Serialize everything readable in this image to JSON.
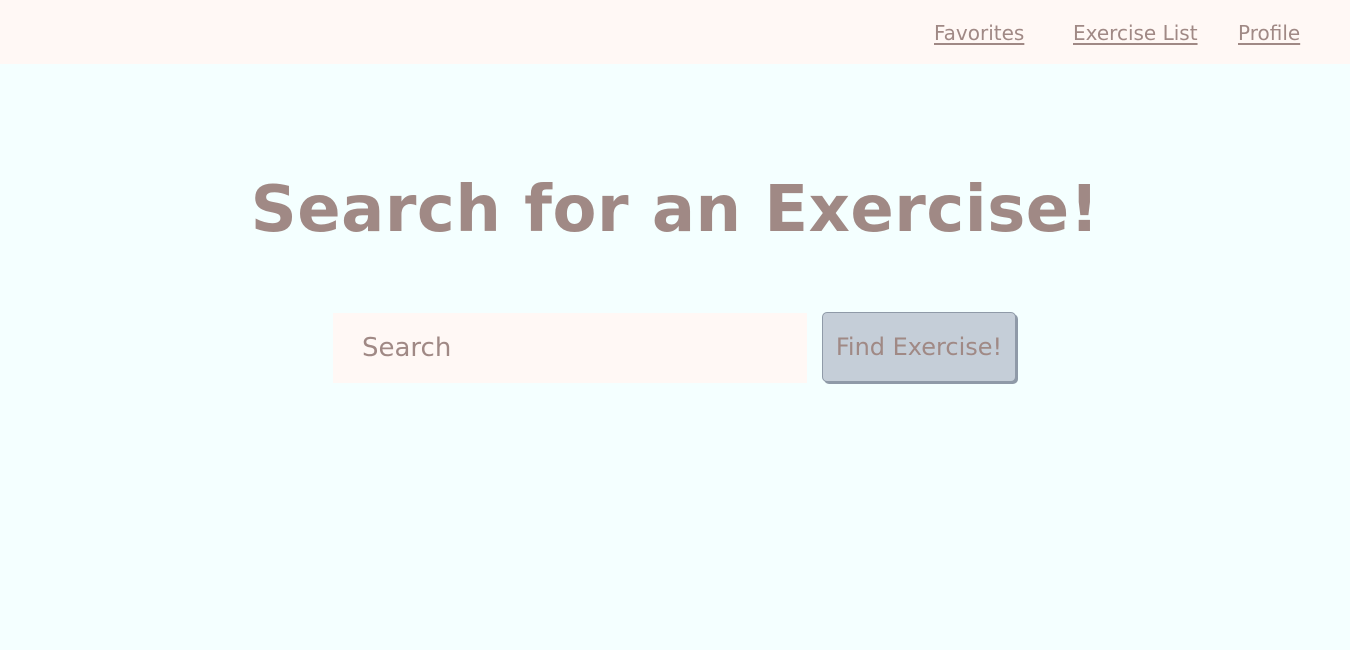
{
  "nav": {
    "links": [
      {
        "label": "Favorites"
      },
      {
        "label": "Exercise List"
      },
      {
        "label": "Profile"
      }
    ]
  },
  "main": {
    "title": "Search for an Exercise!",
    "search": {
      "placeholder": "Search",
      "value": ""
    },
    "find_button_label": "Find Exercise!"
  },
  "colors": {
    "background": "#f4ffff",
    "topbar": "#fff8f5",
    "text": "#a08985",
    "button": "#c5ced8"
  }
}
